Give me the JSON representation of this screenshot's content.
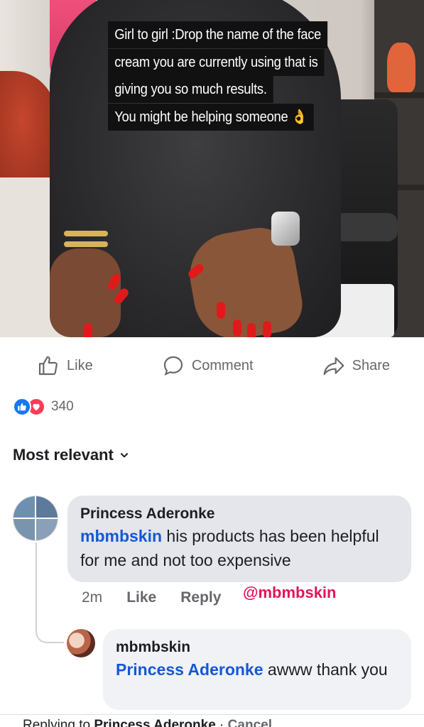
{
  "post": {
    "caption_lines": [
      "Girl to girl :Drop the name of the face",
      "cream you are currently using that is",
      "giving you so much results.",
      "You might be helping someone 👌"
    ]
  },
  "actions": {
    "like": "Like",
    "comment": "Comment",
    "share": "Share"
  },
  "reactions": {
    "count": "340"
  },
  "sort": {
    "label": "Most relevant"
  },
  "comments": [
    {
      "author": "Princess Aderonke",
      "mention": "mbmbskin",
      "text": " his products has been helpful for me and not too expensive",
      "time": "2m",
      "like_label": "Like",
      "reply_label": "Reply"
    }
  ],
  "overlay_tag": "@mbmbskin",
  "reply": {
    "author": "mbmbskin",
    "mention": "Princess Aderonke",
    "text": " awww thank you"
  },
  "reply_bar": {
    "prefix": "Replying to ",
    "name": "Princess Aderonke",
    "separator": " · ",
    "cancel": "Cancel"
  }
}
